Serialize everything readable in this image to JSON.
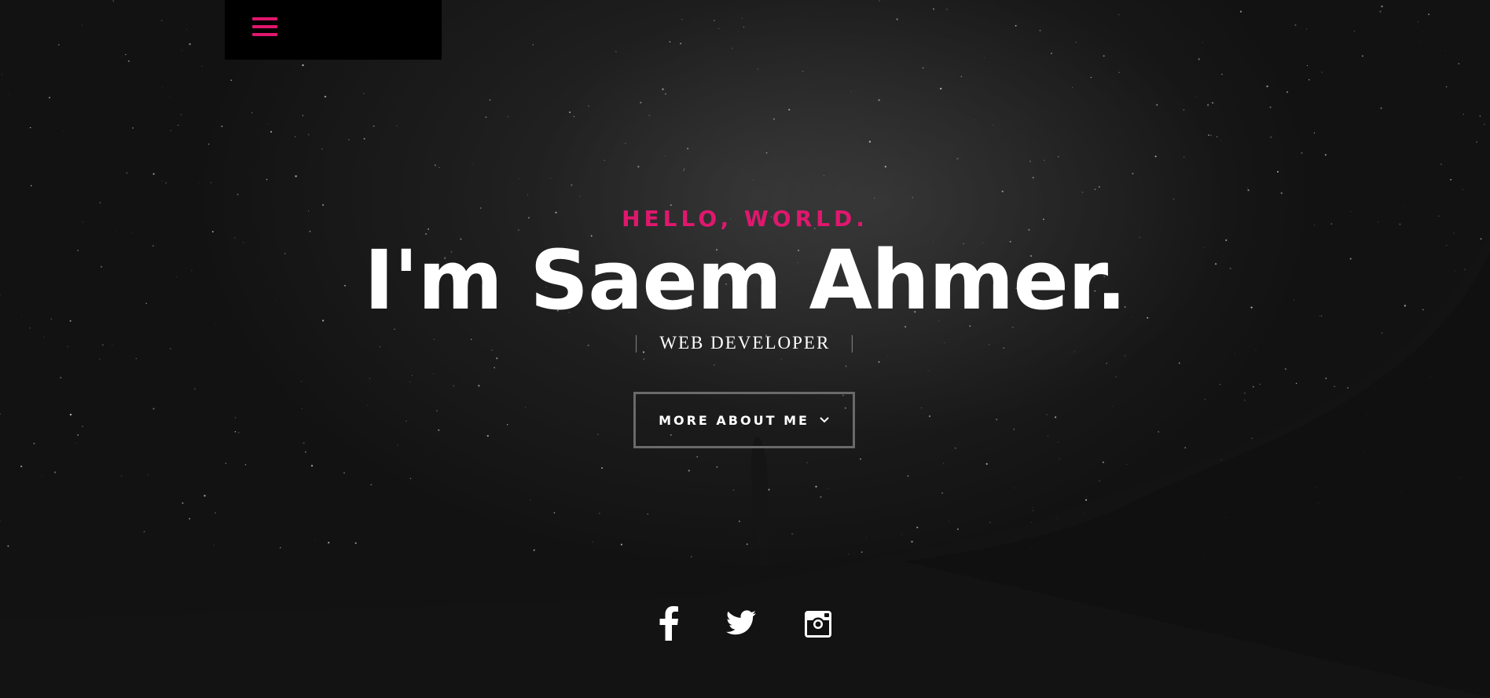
{
  "nav": {
    "menu_icon": "hamburger-menu-icon"
  },
  "hero": {
    "greeting": "HELLO, WORLD.",
    "name": "I'm Saem Ahmer.",
    "role": "WEB DEVELOPER",
    "role_separator": "|",
    "cta_label": "MORE ABOUT ME",
    "cta_icon": "chevron-down-icon"
  },
  "social": [
    {
      "name": "Facebook",
      "icon": "facebook-icon"
    },
    {
      "name": "Twitter",
      "icon": "twitter-icon"
    },
    {
      "name": "Instagram",
      "icon": "instagram-icon"
    }
  ],
  "colors": {
    "accent": "#e0176e",
    "background": "#111111",
    "text": "#ffffff",
    "button_border": "#6a6a6a"
  }
}
